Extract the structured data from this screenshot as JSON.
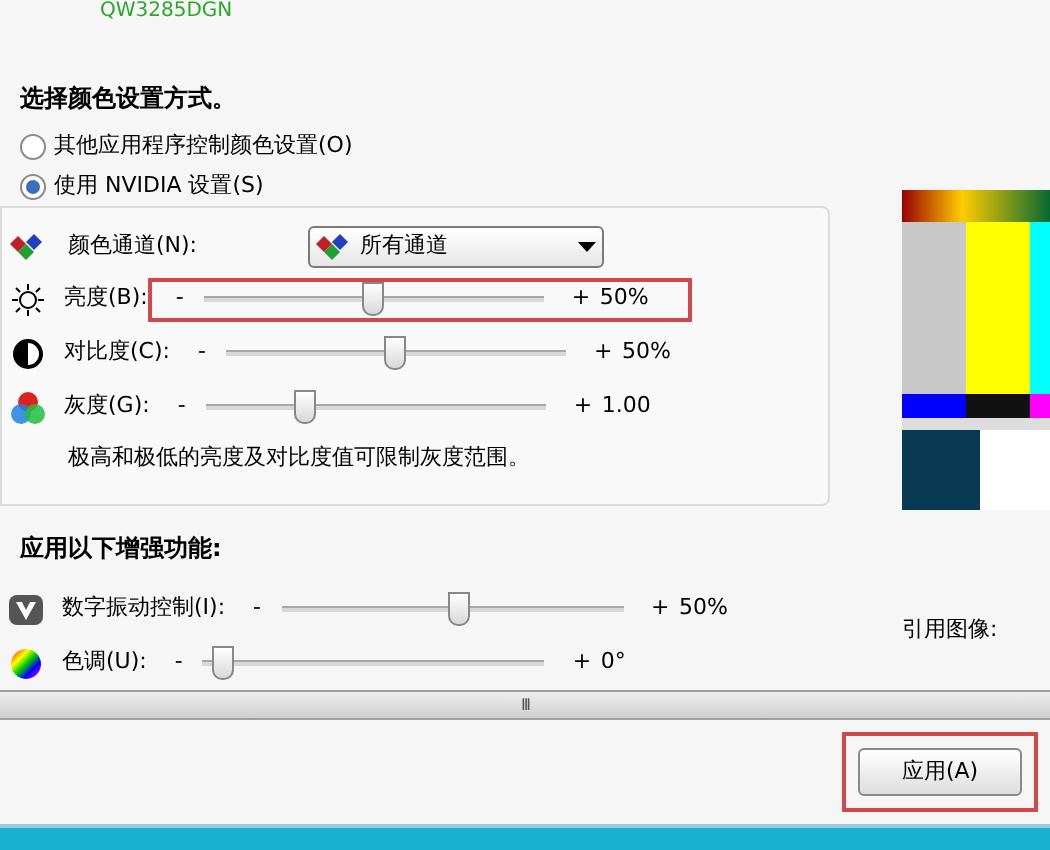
{
  "monitor_name": "QW3285DGN",
  "color_method": {
    "heading": "选择颜色设置方式。",
    "options": [
      {
        "label": "其他应用程序控制颜色设置(O)",
        "selected": false
      },
      {
        "label": "使用 NVIDIA 设置(S)",
        "selected": true
      }
    ]
  },
  "channel": {
    "label": "颜色通道(N):",
    "value": "所有通道"
  },
  "adjustments": [
    {
      "kind": "brightness",
      "label": "亮度(B):",
      "minus": "-",
      "plus": "+",
      "level": 0.5,
      "reading": "50%",
      "highlighted": true
    },
    {
      "kind": "contrast",
      "label": "对比度(C):",
      "minus": "-",
      "plus": "+",
      "level": 0.5,
      "reading": "50%",
      "highlighted": false
    },
    {
      "kind": "gamma",
      "label": "灰度(G):",
      "minus": "-",
      "plus": "+",
      "level": 0.28,
      "reading": "1.00",
      "highlighted": false
    }
  ],
  "note": "极高和极低的亮度及对比度值可限制灰度范围。",
  "enhancements": {
    "heading": "应用以下增强功能:",
    "sliders": [
      {
        "kind": "vibrance",
        "label": "数字振动控制(I):",
        "minus": "-",
        "plus": "+",
        "level": 0.52,
        "reading": "50%"
      },
      {
        "kind": "hue",
        "label": "色调(U):",
        "minus": "-",
        "plus": "+",
        "level": 0.03,
        "reading": "0°"
      }
    ]
  },
  "reference_label": "引用图像:",
  "grip": "III",
  "apply_button": {
    "label": "应用(A)",
    "highlighted": true
  }
}
